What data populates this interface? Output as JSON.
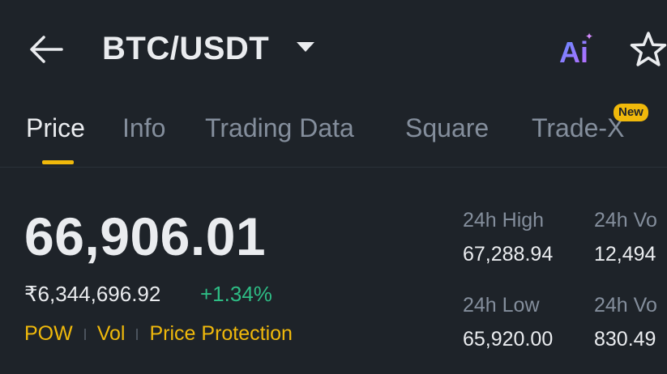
{
  "header": {
    "back_icon": "arrow-left-icon",
    "pair": "BTC/USDT",
    "pair_dropdown_icon": "caret-down-icon",
    "ai_label": "Ai",
    "favorite_icon": "star-outline-icon"
  },
  "tabs": [
    {
      "label": "Price",
      "active": true
    },
    {
      "label": "Info",
      "active": false
    },
    {
      "label": "Trading Data",
      "active": false
    },
    {
      "label": "Square",
      "active": false
    },
    {
      "label": "Trade-X",
      "active": false,
      "badge": "New"
    }
  ],
  "ticker": {
    "last_price": "66,906.01",
    "fiat_price": "₹6,344,696.92",
    "change_pct": "+1.34%",
    "tags": [
      "POW",
      "Vol",
      "Price Protection"
    ]
  },
  "stats": {
    "high_label": "24h High",
    "high_value": "67,288.94",
    "vol1_label": "24h Vo",
    "vol1_value": "12,494",
    "low_label": "24h Low",
    "low_value": "65,920.00",
    "vol2_label": "24h Vo",
    "vol2_value": "830.49"
  },
  "colors": {
    "background": "#1e2329",
    "accent": "#f0b90b",
    "positive": "#2ebd85",
    "muted": "#848e9c",
    "text": "#eaecef"
  }
}
